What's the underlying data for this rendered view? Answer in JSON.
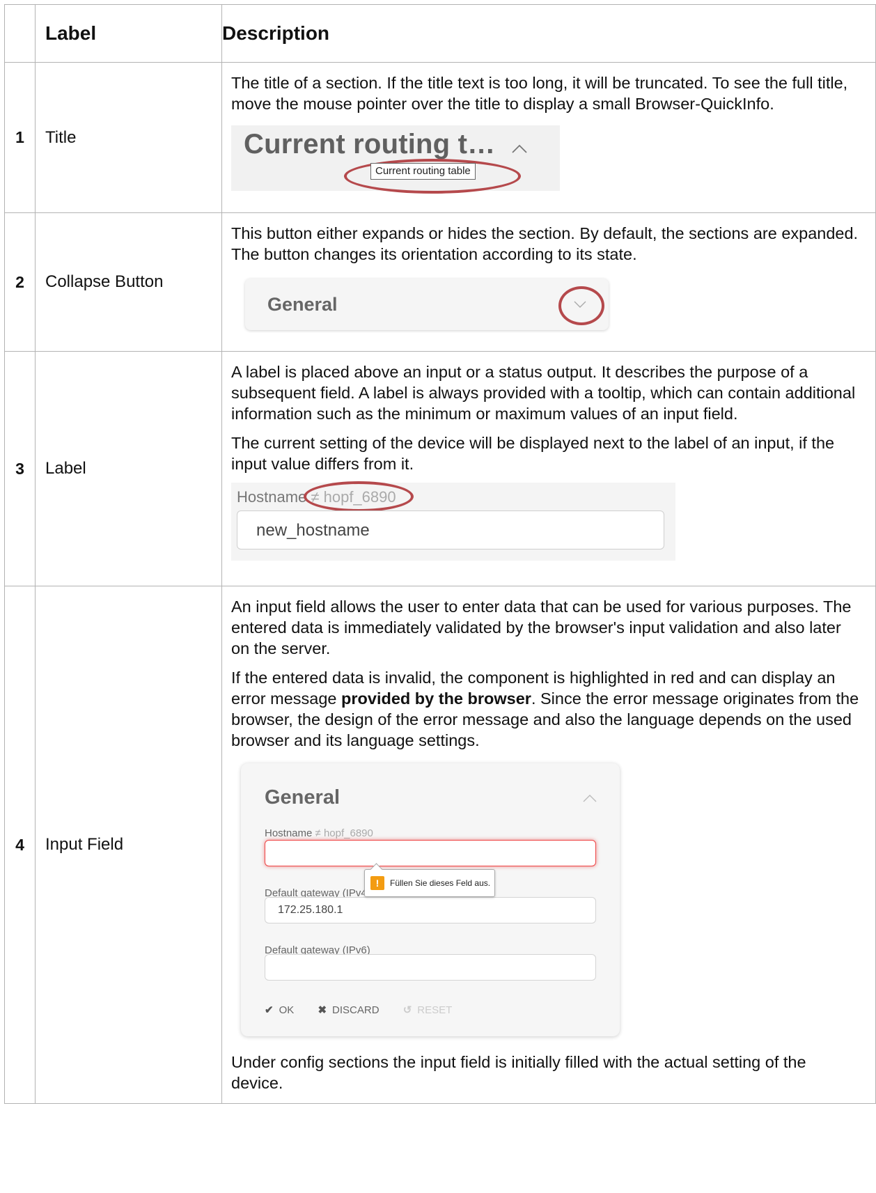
{
  "headers": {
    "label": "Label",
    "description": "Description"
  },
  "rows": [
    {
      "num": "1",
      "label": "Title",
      "paragraphs": [
        "The title of a section. If the title text is too long, it will be truncated. To see the full title, move the mouse pointer over the title to display a small Browser-QuickInfo."
      ],
      "example": {
        "title": "Current routing t…",
        "tooltip": "Current routing table"
      }
    },
    {
      "num": "2",
      "label": "Collapse Button",
      "paragraphs": [
        "This button either expands or hides the section. By default, the sections are expanded. The button changes its orientation according to its state."
      ],
      "example": {
        "section_title": "General"
      }
    },
    {
      "num": "3",
      "label": "Label",
      "paragraphs": [
        "A label is placed above an input or a status output. It describes the purpose of a subsequent field. A label is always provided with a tooltip, which can contain additional information such as the minimum or maximum values of an input field.",
        "The current setting of the device will be displayed next to the label of an input, if the input value differs from it."
      ],
      "example": {
        "field_label": "Hostname",
        "not_equal": "≠",
        "current_value": "hopf_6890",
        "input_value": "new_hostname"
      }
    },
    {
      "num": "4",
      "label": "Input Field",
      "paragraphs": [
        "An input field allows the user to enter data that can be used for various purposes. The entered data is immediately validated by the browser's input validation and also later on the server."
      ],
      "para2_before": "If the entered data is invalid, the component is highlighted in red and can display an error message ",
      "para2_bold": "provided by the browser",
      "para2_after": ". Since the error message originates from the browser, the design of the error message and also the language depends on the used browser and its language settings.",
      "example": {
        "section_title": "General",
        "hostname_label": "Hostname",
        "not_equal": "≠",
        "hostname_current": "hopf_6890",
        "hostname_value": "",
        "gw4_label": "Default gateway (IPv4",
        "gw4_value": "172.25.180.1",
        "gw6_label": "Default gateway (IPv6)",
        "gw6_value": "",
        "error_message": "Füllen Sie dieses Feld aus.",
        "ok_label": "OK",
        "discard_label": "DISCARD",
        "reset_label": "RESET"
      },
      "closing": "Under config sections the input field is initially filled with the actual setting of the device."
    }
  ]
}
